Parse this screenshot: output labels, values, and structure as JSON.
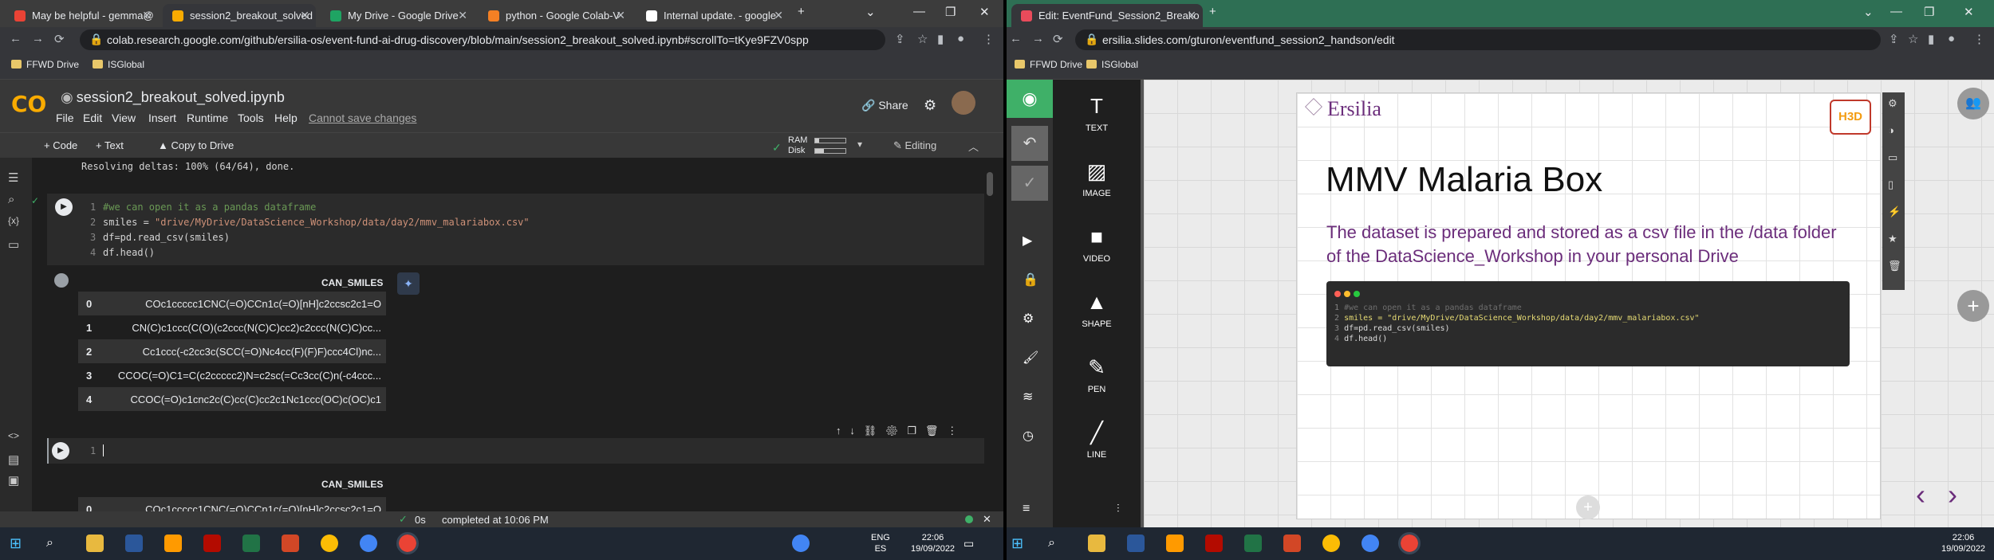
{
  "left": {
    "tabs": [
      {
        "label": "May be helpful - gemma@",
        "fav_color": "#ea4335"
      },
      {
        "label": "session2_breakout_solved",
        "fav_color": "#f9ab00",
        "active": true
      },
      {
        "label": "My Drive - Google Drive",
        "fav_color": "#1fa463"
      },
      {
        "label": "python - Google Colab-V",
        "fav_color": "#f48024"
      },
      {
        "label": "Internal update. - google",
        "fav_color": "#ffffff"
      }
    ],
    "url": "colab.research.google.com/github/ersilia-os/event-fund-ai-drug-discovery/blob/main/session2_breakout_solved.ipynb#scrollTo=tKye9FZV0spp",
    "bookmarks": [
      "FFWD Drive",
      "ISGlobal"
    ],
    "notebook_title": "session2_breakout_solved.ipynb",
    "menu": [
      "File",
      "Edit",
      "View",
      "Insert",
      "Runtime",
      "Tools",
      "Help"
    ],
    "cannot_save": "Cannot save changes",
    "share": "Share",
    "toolbar": {
      "code": "+ Code",
      "text": "+ Text",
      "copy": "Copy to Drive",
      "ram": "RAM",
      "disk": "Disk",
      "editing": "Editing"
    },
    "output_prev": "Resolving deltas: 100% (64/64), done.",
    "cell1": {
      "lines": [
        {
          "n": "1",
          "parts": [
            {
              "cls": "cmt",
              "t": "#we can open it as a pandas dataframe"
            }
          ]
        },
        {
          "n": "2",
          "parts": [
            {
              "cls": "",
              "t": "smiles = "
            },
            {
              "cls": "str",
              "t": "\"drive/MyDrive/DataScience_Workshop/data/day2/mmv_malariabox.csv\""
            }
          ]
        },
        {
          "n": "3",
          "parts": [
            {
              "cls": "",
              "t": "df=pd.read_csv(smiles)"
            }
          ]
        },
        {
          "n": "4",
          "parts": [
            {
              "cls": "",
              "t": "df.head()"
            }
          ]
        }
      ]
    },
    "df": {
      "header": "CAN_SMILES",
      "rows": [
        {
          "idx": "0",
          "val": "COc1ccccc1CNC(=O)CCn1c(=O)[nH]c2ccsc2c1=O"
        },
        {
          "idx": "1",
          "val": "CN(C)c1ccc(C(O)(c2ccc(N(C)C)cc2)c2ccc(N(C)C)cc..."
        },
        {
          "idx": "2",
          "val": "Cc1ccc(-c2cc3c(SCC(=O)Nc4cc(F)(F)F)ccc4Cl)nc..."
        },
        {
          "idx": "3",
          "val": "CCOC(=O)C1=C(c2ccccc2)N=c2sc(=Cc3cc(C)n(-c4ccc..."
        },
        {
          "idx": "4",
          "val": "CCOC(=O)c1cnc2c(C)cc(C)cc2c1Nc1ccc(OC)c(OC)c1"
        }
      ]
    },
    "cell2_line": "1",
    "df2_header": "CAN_SMILES",
    "df2_partial": "COc1ccccc1CNC(=O)CCn1c(=O)[nH]c2ccsc2c1=O",
    "status": {
      "time": "0s",
      "text": "completed at 10:06 PM"
    },
    "clock": {
      "lang": "ENG",
      "region": "ES",
      "time": "22:06",
      "date": "19/09/2022"
    }
  },
  "right": {
    "tab": "Edit: EventFund_Session2_Breako",
    "url": "ersilia.slides.com/gturon/eventfund_session2_handson/edit",
    "bookmarks": [
      "FFWD Drive",
      "ISGlobal"
    ],
    "tools": [
      "TEXT",
      "IMAGE",
      "VIDEO",
      "SHAPE",
      "PEN",
      "LINE"
    ],
    "slide": {
      "brand": "Ersilia",
      "logo_text": "H3D",
      "title": "MMV Malaria Box",
      "body": "The dataset is prepared and stored as a csv file in the /data folder of the DataScience_Workshop in your personal Drive",
      "code": [
        {
          "n": "1",
          "t": "#we can open it as a pandas dataframe",
          "cls": "cmt"
        },
        {
          "n": "2",
          "t": "smiles = \"drive/MyDrive/DataScience_Workshop/data/day2/mmv_malariabox.csv\"",
          "cls": "str"
        },
        {
          "n": "3",
          "t": "df=pd.read_csv(smiles)",
          "cls": ""
        },
        {
          "n": "4",
          "t": "df.head()",
          "cls": ""
        }
      ]
    },
    "clock": {
      "time": "22:06",
      "date": "19/09/2022"
    }
  },
  "colors": {
    "accent_green": "#3fb068",
    "colab_orange": "#f9ab00",
    "slide_purple": "#6b2d7b"
  }
}
